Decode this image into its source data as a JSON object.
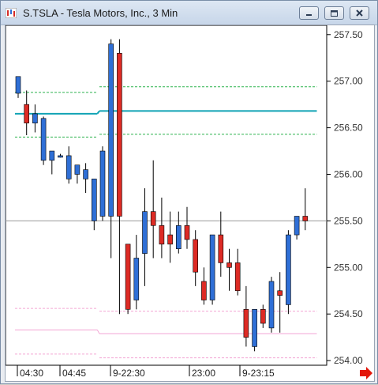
{
  "window": {
    "title": "S.TSLA - Tesla Motors, Inc., 3 Min",
    "buttons": [
      "minimize",
      "restore",
      "close"
    ]
  },
  "icons": {
    "app": "chart-app-icon",
    "minimize": "minimize-icon",
    "restore": "restore-icon",
    "close": "close-icon",
    "scroll": "red-arrow-right-icon"
  },
  "colors": {
    "up_candle": "#2f6fd6",
    "down_candle": "#dd2b25",
    "wick": "#000000",
    "vwap": "#11a3b5",
    "band_green": "#2fb34f",
    "band_pink": "#f3a6d4",
    "reference_gray": "#9a9a9a"
  },
  "chart_data": {
    "type": "candlestick",
    "title": "",
    "y_axis": {
      "ticks": [
        "257.50",
        "257.00",
        "256.50",
        "256.00",
        "255.50",
        "255.00",
        "254.50",
        "254.00"
      ],
      "min": 253.95,
      "max": 257.6
    },
    "x_axis": {
      "ticks": [
        "04:30",
        "04:45",
        "9-22:30",
        "23:00",
        "9-23:15"
      ]
    },
    "reference_line": 255.5,
    "candles": [
      {
        "o": 256.87,
        "h": 257.05,
        "l": 256.82,
        "c": 257.05
      },
      {
        "o": 256.75,
        "h": 256.9,
        "l": 256.42,
        "c": 256.55
      },
      {
        "o": 256.55,
        "h": 256.75,
        "l": 256.45,
        "c": 256.65
      },
      {
        "o": 256.15,
        "h": 256.62,
        "l": 256.1,
        "c": 256.6
      },
      {
        "o": 256.15,
        "h": 256.25,
        "l": 256.0,
        "c": 256.25
      },
      {
        "o": 256.2,
        "h": 256.22,
        "l": 256.18,
        "c": 256.2
      },
      {
        "o": 255.95,
        "h": 256.3,
        "l": 255.9,
        "c": 256.2
      },
      {
        "o": 256.0,
        "h": 256.1,
        "l": 255.9,
        "c": 256.1
      },
      {
        "o": 255.95,
        "h": 256.12,
        "l": 255.8,
        "c": 256.05
      },
      {
        "o": 255.5,
        "h": 255.95,
        "l": 255.4,
        "c": 255.95
      },
      {
        "o": 255.55,
        "h": 256.3,
        "l": 255.5,
        "c": 256.25
      },
      {
        "o": 255.55,
        "h": 257.45,
        "l": 255.1,
        "c": 257.4
      },
      {
        "o": 257.3,
        "h": 257.45,
        "l": 254.5,
        "c": 255.55
      },
      {
        "o": 255.25,
        "h": 254.5,
        "l": 254.5,
        "c": 254.55
      },
      {
        "o": 254.65,
        "h": 255.35,
        "l": 254.55,
        "c": 255.1
      },
      {
        "o": 255.15,
        "h": 255.85,
        "l": 254.8,
        "c": 255.6
      },
      {
        "o": 255.6,
        "h": 256.15,
        "l": 255.1,
        "c": 255.45
      },
      {
        "o": 255.45,
        "h": 255.75,
        "l": 255.1,
        "c": 255.25
      },
      {
        "o": 255.35,
        "h": 255.6,
        "l": 255.05,
        "c": 255.25
      },
      {
        "o": 255.2,
        "h": 255.6,
        "l": 255.15,
        "c": 255.45
      },
      {
        "o": 255.45,
        "h": 255.65,
        "l": 255.2,
        "c": 255.3
      },
      {
        "o": 255.3,
        "h": 255.4,
        "l": 254.8,
        "c": 254.95
      },
      {
        "o": 254.85,
        "h": 255.0,
        "l": 254.6,
        "c": 254.65
      },
      {
        "o": 254.65,
        "h": 255.35,
        "l": 254.6,
        "c": 255.35
      },
      {
        "o": 255.35,
        "h": 255.6,
        "l": 254.9,
        "c": 255.05
      },
      {
        "o": 255.05,
        "h": 255.2,
        "l": 254.75,
        "c": 255.0
      },
      {
        "o": 255.05,
        "h": 255.2,
        "l": 254.7,
        "c": 254.75
      },
      {
        "o": 254.55,
        "h": 254.8,
        "l": 254.15,
        "c": 254.25
      },
      {
        "o": 254.15,
        "h": 254.55,
        "l": 254.1,
        "c": 254.55
      },
      {
        "o": 254.55,
        "h": 254.6,
        "l": 254.35,
        "c": 254.4
      },
      {
        "o": 254.35,
        "h": 254.9,
        "l": 254.3,
        "c": 254.85
      },
      {
        "o": 254.75,
        "h": 254.95,
        "l": 254.3,
        "c": 254.7
      },
      {
        "o": 254.6,
        "h": 255.4,
        "l": 254.5,
        "c": 255.35
      },
      {
        "o": 255.35,
        "h": 255.55,
        "l": 255.3,
        "c": 255.55
      },
      {
        "o": 255.55,
        "h": 255.85,
        "l": 255.4,
        "c": 255.5
      }
    ],
    "lines": [
      {
        "name": "",
        "color": "#11a3b5",
        "segments": [
          [
            0,
            9,
            256.65
          ],
          [
            10,
            35,
            256.68
          ]
        ]
      },
      {
        "name": "",
        "color": "#2fb34f",
        "dashed": true,
        "segments": [
          [
            0,
            9,
            256.88
          ],
          [
            10,
            35,
            256.94
          ],
          [
            0,
            9,
            256.4
          ],
          [
            10,
            35,
            256.43
          ]
        ]
      },
      {
        "name": "",
        "color": "#f3a6d4",
        "dashed": true,
        "segments": [
          [
            0,
            9,
            254.56
          ],
          [
            10,
            35,
            254.53
          ],
          [
            10,
            35,
            254.03
          ],
          [
            0,
            9,
            254.07
          ]
        ]
      },
      {
        "name": "",
        "color": "#f3a6d4",
        "dashed": false,
        "segments": [
          [
            0,
            9,
            254.33
          ],
          [
            10,
            35,
            254.29
          ]
        ]
      }
    ]
  }
}
